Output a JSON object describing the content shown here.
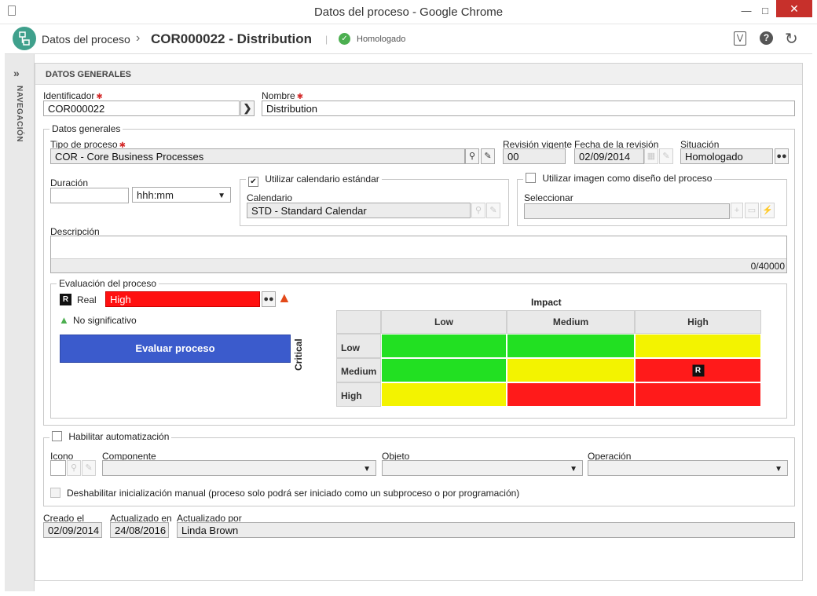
{
  "window": {
    "title": "Datos del proceso - Google Chrome"
  },
  "header": {
    "breadcrumb": "Datos del proceso",
    "record_title": "COR000022 - Distribution",
    "status": "Homologado"
  },
  "nav_rail": {
    "label": "NAVEGACIÓN"
  },
  "section_title": "DATOS GENERALES",
  "form": {
    "identificador": {
      "label": "Identificador",
      "value": "COR000022"
    },
    "nombre": {
      "label": "Nombre",
      "value": "Distribution"
    },
    "datos_generales": {
      "legend": "Datos generales",
      "tipo_proceso": {
        "label": "Tipo de proceso",
        "value": "COR - Core Business Processes"
      },
      "revision_vigente": {
        "label": "Revisión vigente",
        "value": "00"
      },
      "fecha_revision": {
        "label": "Fecha de la revisión",
        "value": "02/09/2014"
      },
      "situacion": {
        "label": "Situación",
        "value": "Homologado"
      },
      "duracion": {
        "label": "Duración",
        "value": "",
        "unit": "hhh:mm"
      },
      "calendario_box": {
        "checkbox_label": "Utilizar calendario estándar",
        "checked": true,
        "label": "Calendario",
        "value": "STD - Standard Calendar"
      },
      "imagen_box": {
        "checkbox_label": "Utilizar imagen como diseño del proceso",
        "checked": false,
        "label": "Seleccionar",
        "value": ""
      },
      "descripcion": {
        "label": "Descripción",
        "value": "",
        "counter": "0/40000"
      },
      "evaluacion": {
        "legend": "Evaluación del proceso",
        "real_badge": "R",
        "real_label": "Real",
        "real_value": "High",
        "warning_text": "No significativo",
        "evaluate_button": "Evaluar proceso",
        "matrix": {
          "x_title": "Impact",
          "y_title": "Critical",
          "columns": [
            "Low",
            "Medium",
            "High"
          ],
          "rows": [
            "Low",
            "Medium",
            "High"
          ],
          "colors": {
            "green": "#22e022",
            "yellow": "#f3f300",
            "red": "#ff1a1a"
          },
          "cells": [
            [
              "green",
              "green",
              "yellow"
            ],
            [
              "green",
              "yellow",
              "red"
            ],
            [
              "yellow",
              "red",
              "red"
            ]
          ],
          "marker": {
            "row": 1,
            "col": 2,
            "text": "R"
          }
        }
      }
    },
    "automatizacion": {
      "checkbox_label": "Habilitar automatización",
      "checked": false,
      "icono_label": "Icono",
      "componente_label": "Componente",
      "objeto_label": "Objeto",
      "operacion_label": "Operación",
      "deshabilitar_label": "Deshabilitar inicialización manual (proceso solo podrá ser iniciado como un subproceso o por programación)"
    },
    "audit": {
      "creado_label": "Creado el",
      "creado_value": "02/09/2014",
      "actualizado_label": "Actualizado en",
      "actualizado_value": "24/08/2016",
      "actualizado_por_label": "Actualizado por",
      "actualizado_por_value": "Linda Brown"
    }
  },
  "colors": {
    "accent_button": "#3b5bcc",
    "real_field": "#ff1010",
    "status_green": "#4caf50",
    "required": "#d42b2b"
  }
}
